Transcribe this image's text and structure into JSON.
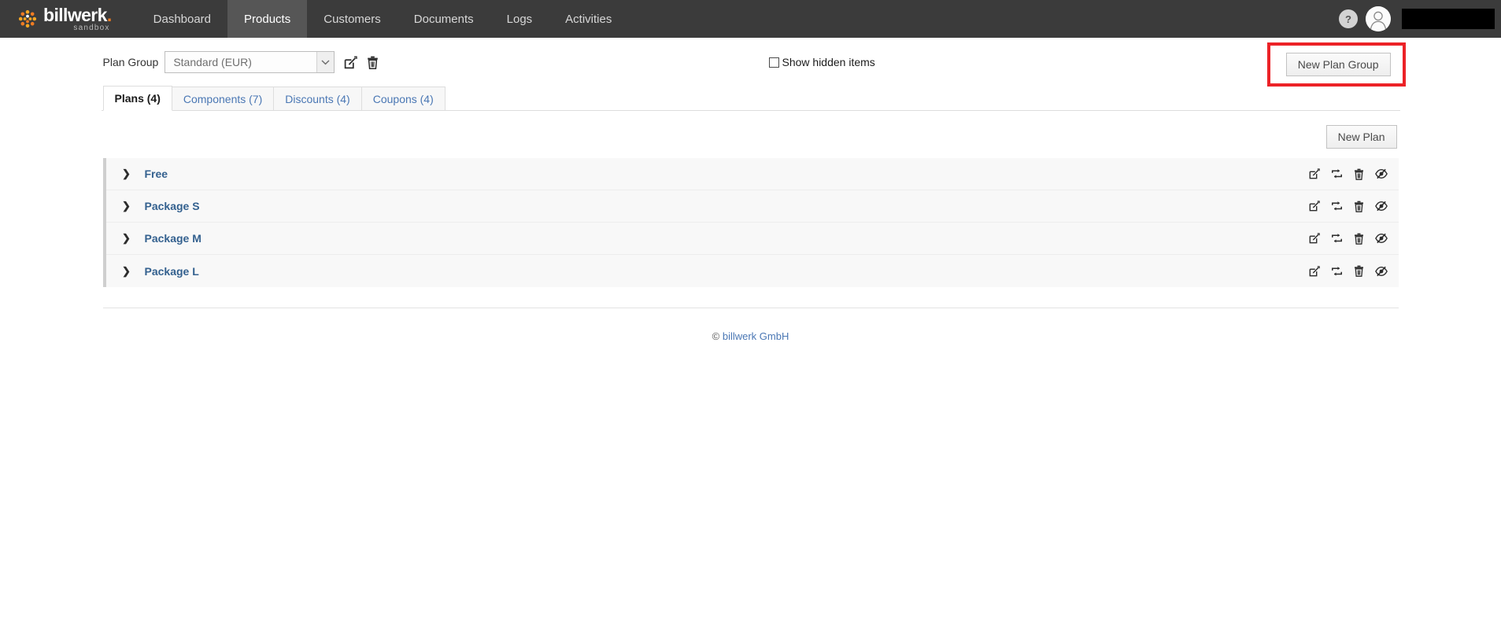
{
  "brand": {
    "name": "billwerk",
    "name_dot": ".",
    "sub": "sandbox",
    "logo_icon": "billwerk-dots-logo"
  },
  "nav": {
    "items": [
      {
        "label": "Dashboard",
        "active": false
      },
      {
        "label": "Products",
        "active": true
      },
      {
        "label": "Customers",
        "active": false
      },
      {
        "label": "Documents",
        "active": false
      },
      {
        "label": "Logs",
        "active": false
      },
      {
        "label": "Activities",
        "active": false
      }
    ],
    "help_label": "?",
    "help_icon": "question-mark-icon",
    "avatar_icon": "user-avatar-icon",
    "redacted_label": ""
  },
  "toolbar": {
    "plan_group_label": "Plan Group",
    "plan_group_value": "Standard (EUR)",
    "plan_group_options": [
      "Standard (EUR)"
    ],
    "edit_icon": "edit-pencil-square-icon",
    "delete_icon": "trash-icon",
    "show_hidden_label": "Show hidden items",
    "show_hidden_checked": false,
    "new_plan_group_label": "New Plan Group",
    "highlight_color": "#ec2227"
  },
  "tabs": [
    {
      "label": "Plans (4)",
      "active": true
    },
    {
      "label": "Components (7)",
      "active": false
    },
    {
      "label": "Discounts (4)",
      "active": false
    },
    {
      "label": "Coupons (4)",
      "active": false
    }
  ],
  "content": {
    "new_plan_label": "New Plan",
    "row_icons": {
      "edit": "edit-pencil-square-icon",
      "duplicate": "duplicate-icon",
      "delete": "trash-icon",
      "hide": "eye-slash-icon"
    },
    "expander_icon": "chevron-right-icon",
    "plans": [
      {
        "name": "Free"
      },
      {
        "name": "Package S"
      },
      {
        "name": "Package M"
      },
      {
        "name": "Package L"
      }
    ]
  },
  "footer": {
    "copyright": "©",
    "company": "billwerk GmbH"
  },
  "colors": {
    "navbar": "#3b3b3b",
    "nav_active": "#565656",
    "brand_orange": "#f07c22",
    "link_blue": "#4a77b4",
    "plan_name_blue": "#34618f",
    "row_bg": "#f8f8f8"
  }
}
